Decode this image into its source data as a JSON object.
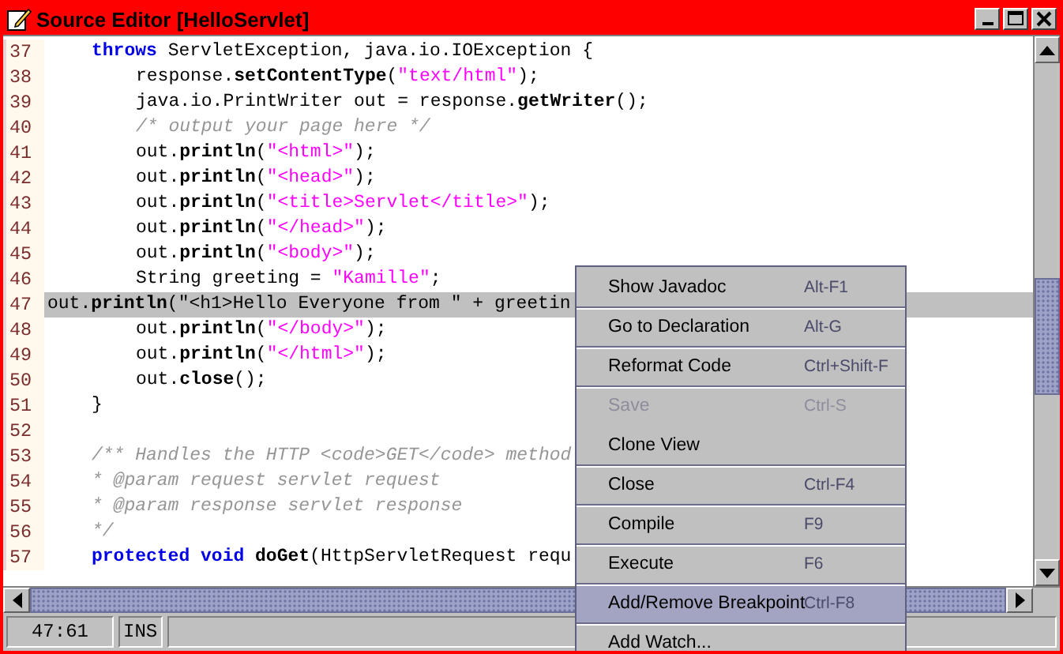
{
  "window": {
    "title": "Source Editor [HelloServlet]"
  },
  "editor": {
    "lines": [
      {
        "number": "37",
        "selected": false,
        "kind": "outer",
        "segments": [
          {
            "kind": "keyword",
            "text": "throws"
          },
          {
            "kind": "plain",
            "text": " ServletException, java.io.IOException {"
          }
        ]
      },
      {
        "number": "38",
        "selected": false,
        "kind": "inner",
        "segments": [
          {
            "kind": "plain",
            "text": "response."
          },
          {
            "kind": "method",
            "text": "setContentType"
          },
          {
            "kind": "plain",
            "text": "("
          },
          {
            "kind": "string",
            "text": "\"text/html\""
          },
          {
            "kind": "plain",
            "text": ");"
          }
        ]
      },
      {
        "number": "39",
        "selected": false,
        "kind": "inner",
        "segments": [
          {
            "kind": "plain",
            "text": "java.io.PrintWriter out = response."
          },
          {
            "kind": "method",
            "text": "getWriter"
          },
          {
            "kind": "plain",
            "text": "();"
          }
        ]
      },
      {
        "number": "40",
        "selected": false,
        "kind": "inner",
        "segments": [
          {
            "kind": "comment",
            "text": "/* output your page here */"
          }
        ]
      },
      {
        "number": "41",
        "selected": false,
        "kind": "inner",
        "segments": [
          {
            "kind": "plain",
            "text": "out."
          },
          {
            "kind": "method",
            "text": "println"
          },
          {
            "kind": "plain",
            "text": "("
          },
          {
            "kind": "string",
            "text": "\"<html>\""
          },
          {
            "kind": "plain",
            "text": ");"
          }
        ]
      },
      {
        "number": "42",
        "selected": false,
        "kind": "inner",
        "segments": [
          {
            "kind": "plain",
            "text": "out."
          },
          {
            "kind": "method",
            "text": "println"
          },
          {
            "kind": "plain",
            "text": "("
          },
          {
            "kind": "string",
            "text": "\"<head>\""
          },
          {
            "kind": "plain",
            "text": ");"
          }
        ]
      },
      {
        "number": "43",
        "selected": false,
        "kind": "inner",
        "segments": [
          {
            "kind": "plain",
            "text": "out."
          },
          {
            "kind": "method",
            "text": "println"
          },
          {
            "kind": "plain",
            "text": "("
          },
          {
            "kind": "string",
            "text": "\"<title>Servlet</title>\""
          },
          {
            "kind": "plain",
            "text": ");"
          }
        ]
      },
      {
        "number": "44",
        "selected": false,
        "kind": "inner",
        "segments": [
          {
            "kind": "plain",
            "text": "out."
          },
          {
            "kind": "method",
            "text": "println"
          },
          {
            "kind": "plain",
            "text": "("
          },
          {
            "kind": "string",
            "text": "\"</head>\""
          },
          {
            "kind": "plain",
            "text": ");"
          }
        ]
      },
      {
        "number": "45",
        "selected": false,
        "kind": "inner",
        "segments": [
          {
            "kind": "plain",
            "text": "out."
          },
          {
            "kind": "method",
            "text": "println"
          },
          {
            "kind": "plain",
            "text": "("
          },
          {
            "kind": "string",
            "text": "\"<body>\""
          },
          {
            "kind": "plain",
            "text": ");"
          }
        ]
      },
      {
        "number": "46",
        "selected": false,
        "kind": "inner",
        "segments": [
          {
            "kind": "plain",
            "text": "String greeting = "
          },
          {
            "kind": "string",
            "text": "\"Kamille\""
          },
          {
            "kind": "plain",
            "text": ";"
          }
        ]
      },
      {
        "number": "47",
        "selected": true,
        "kind": "flush",
        "segments": [
          {
            "kind": "plain",
            "text": "out."
          },
          {
            "kind": "method",
            "text": "println"
          },
          {
            "kind": "plain",
            "text": "(\"<h1>Hello Everyone from \" + greetin"
          }
        ]
      },
      {
        "number": "48",
        "selected": false,
        "kind": "inner",
        "segments": [
          {
            "kind": "plain",
            "text": "out."
          },
          {
            "kind": "method",
            "text": "println"
          },
          {
            "kind": "plain",
            "text": "("
          },
          {
            "kind": "string",
            "text": "\"</body>\""
          },
          {
            "kind": "plain",
            "text": ");"
          }
        ]
      },
      {
        "number": "49",
        "selected": false,
        "kind": "inner",
        "segments": [
          {
            "kind": "plain",
            "text": "out."
          },
          {
            "kind": "method",
            "text": "println"
          },
          {
            "kind": "plain",
            "text": "("
          },
          {
            "kind": "string",
            "text": "\"</html>\""
          },
          {
            "kind": "plain",
            "text": ");"
          }
        ]
      },
      {
        "number": "50",
        "selected": false,
        "kind": "inner",
        "segments": [
          {
            "kind": "plain",
            "text": "out."
          },
          {
            "kind": "method",
            "text": "close"
          },
          {
            "kind": "plain",
            "text": "();"
          }
        ]
      },
      {
        "number": "51",
        "selected": false,
        "kind": "outer",
        "segments": [
          {
            "kind": "plain",
            "text": "}"
          }
        ]
      },
      {
        "number": "52",
        "selected": false,
        "kind": "flush"
      },
      {
        "number": "53",
        "selected": false,
        "kind": "outer",
        "segments": [
          {
            "kind": "comment",
            "text": "/** Handles the HTTP <code>GET</code> method"
          }
        ]
      },
      {
        "number": "54",
        "selected": false,
        "kind": "outer",
        "segments": [
          {
            "kind": "comment",
            "text": "* @param request servlet request"
          }
        ]
      },
      {
        "number": "55",
        "selected": false,
        "kind": "outer",
        "segments": [
          {
            "kind": "comment",
            "text": "* @param response servlet response"
          }
        ]
      },
      {
        "number": "56",
        "selected": false,
        "kind": "outer",
        "segments": [
          {
            "kind": "comment",
            "text": "*/"
          }
        ]
      },
      {
        "number": "57",
        "selected": false,
        "kind": "outer",
        "segments": [
          {
            "kind": "keyword",
            "text": "protected void"
          },
          {
            "kind": "method",
            "text": " doGet"
          },
          {
            "kind": "plain",
            "text": "(HttpServletRequest requ"
          }
        ]
      }
    ]
  },
  "status_bar": {
    "position": "47:61",
    "mode": "INS"
  },
  "context_menu": {
    "items": [
      {
        "label": "Show Javadoc",
        "shortcut": "Alt-F1",
        "disabled": false,
        "selected": false,
        "separator_before": false
      },
      {
        "label": "Go to Declaration",
        "shortcut": "Alt-G",
        "disabled": false,
        "selected": false,
        "separator_before": true
      },
      {
        "label": "Reformat Code",
        "shortcut": "Ctrl+Shift-F",
        "disabled": false,
        "selected": false,
        "separator_before": true
      },
      {
        "label": "Save",
        "shortcut": "Ctrl-S",
        "disabled": true,
        "selected": false,
        "separator_before": true
      },
      {
        "label": "Clone View",
        "disabled": false,
        "selected": false,
        "separator_before": false
      },
      {
        "label": "Close",
        "shortcut": "Ctrl-F4",
        "disabled": false,
        "selected": false,
        "separator_before": true
      },
      {
        "label": "Compile",
        "shortcut": "F9",
        "disabled": false,
        "selected": false,
        "separator_before": true
      },
      {
        "label": "Execute",
        "shortcut": "F6",
        "disabled": false,
        "selected": false,
        "separator_before": true
      },
      {
        "label": "Add/Remove Breakpoint",
        "shortcut": "Ctrl-F8",
        "disabled": false,
        "selected": true,
        "separator_before": true
      },
      {
        "label": "Add Watch...",
        "disabled": false,
        "selected": false,
        "separator_before": true
      }
    ]
  }
}
